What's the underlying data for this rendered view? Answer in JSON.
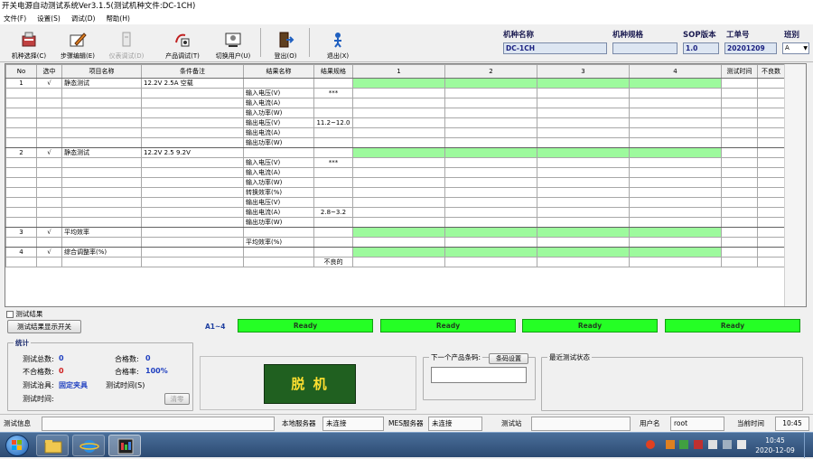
{
  "app": {
    "title": "开关电源自动测试系统Ver3.1.5(测试机种文件:DC-1CH)"
  },
  "menu": [
    "文件(F)",
    "设置(S)",
    "调试(D)",
    "帮助(H)"
  ],
  "toolbar": {
    "model_select": "机种选择(C)",
    "step_edit": "步骤编辑(E)",
    "instrument_debug": "仪表调试(D)",
    "product_debug": "产品调试(T)",
    "switch_user": "切换用户(U)",
    "logout": "登出(O)",
    "exit": "退出(X)"
  },
  "header": {
    "model_name_label": "机种名称",
    "model_name_value": "DC-1CH",
    "model_spec_label": "机种规格",
    "model_spec_value": "",
    "sop_label": "SOP版本",
    "sop_value": "1.0",
    "order_label": "工单号",
    "order_value": "20201209",
    "shift_label": "班别",
    "shift_value": "A"
  },
  "table": {
    "columns": [
      "No",
      "选中",
      "项目名称",
      "条件备注",
      "结果名称",
      "结果规格",
      "1",
      "2",
      "3",
      "4",
      "测试时间",
      "不良数"
    ],
    "rows": [
      {
        "no": "1",
        "sel": "√",
        "item": "静态测试",
        "cond": "12.2V 2.5A 空载",
        "res": "",
        "spec": "",
        "green": true
      },
      {
        "no": "",
        "sel": "",
        "item": "",
        "cond": "",
        "res": "输入电压(V)",
        "spec": "***",
        "green": false
      },
      {
        "no": "",
        "sel": "",
        "item": "",
        "cond": "",
        "res": "输入电流(A)",
        "spec": "",
        "green": false
      },
      {
        "no": "",
        "sel": "",
        "item": "",
        "cond": "",
        "res": "输入功率(W)",
        "spec": "",
        "green": false
      },
      {
        "no": "",
        "sel": "",
        "item": "",
        "cond": "",
        "res": "输出电压(V)",
        "spec": "11.2~12.0",
        "green": false
      },
      {
        "no": "",
        "sel": "",
        "item": "",
        "cond": "",
        "res": "输出电流(A)",
        "spec": "",
        "green": false
      },
      {
        "no": "",
        "sel": "",
        "item": "",
        "cond": "",
        "res": "输出功率(W)",
        "spec": "",
        "green": false,
        "sec": true
      },
      {
        "no": "2",
        "sel": "√",
        "item": "静态测试",
        "cond": "12.2V 2.5 9.2V",
        "res": "",
        "spec": "",
        "green": true
      },
      {
        "no": "",
        "sel": "",
        "item": "",
        "cond": "",
        "res": "输入电压(V)",
        "spec": "***",
        "green": false
      },
      {
        "no": "",
        "sel": "",
        "item": "",
        "cond": "",
        "res": "输入电流(A)",
        "spec": "",
        "green": false
      },
      {
        "no": "",
        "sel": "",
        "item": "",
        "cond": "",
        "res": "输入功率(W)",
        "spec": "",
        "green": false
      },
      {
        "no": "",
        "sel": "",
        "item": "",
        "cond": "",
        "res": "转换效率(%)",
        "spec": "",
        "green": false
      },
      {
        "no": "",
        "sel": "",
        "item": "",
        "cond": "",
        "res": "输出电压(V)",
        "spec": "",
        "green": false
      },
      {
        "no": "",
        "sel": "",
        "item": "",
        "cond": "",
        "res": "输出电流(A)",
        "spec": "2.8~3.2",
        "green": false
      },
      {
        "no": "",
        "sel": "",
        "item": "",
        "cond": "",
        "res": "输出功率(W)",
        "spec": "",
        "green": false,
        "sec": true
      },
      {
        "no": "3",
        "sel": "√",
        "item": "平均效率",
        "cond": "",
        "res": "",
        "spec": "",
        "green": true
      },
      {
        "no": "",
        "sel": "",
        "item": "",
        "cond": "",
        "res": "平均效率(%)",
        "spec": "",
        "green": false,
        "sec": true
      },
      {
        "no": "4",
        "sel": "√",
        "item": "综合调整率(%)",
        "cond": "",
        "res": "",
        "spec": "",
        "green": true
      },
      {
        "no": "",
        "sel": "",
        "item": "",
        "cond": "",
        "res": "",
        "spec": "不良的",
        "green": false
      }
    ]
  },
  "results": {
    "group_label": "测试结果",
    "toggle_btn": "测试结果显示开关",
    "range_label": "A1~4",
    "channels": [
      "Ready",
      "Ready",
      "Ready",
      "Ready"
    ]
  },
  "stats": {
    "label": "统计",
    "total_label": "测试总数:",
    "total": "0",
    "pass_label": "合格数:",
    "pass": "0",
    "fail_label": "不合格数:",
    "fail": "0",
    "rate_label": "合格率:",
    "rate": "100%",
    "fixture_label": "测试治具:",
    "fixture": "固定夹具",
    "time_label": "测试时间(S)",
    "test_time_label": "测试时间:",
    "clear_btn": "清零"
  },
  "release_button": "脱 机",
  "next": {
    "label": "下一个产品条码:",
    "setting_btn": "条码设置",
    "value": ""
  },
  "last_state": {
    "label": "最近测试状态"
  },
  "status": {
    "msg_label": "测试信息",
    "server_label": "本地服务器",
    "server_value": "未连接",
    "mes_label": "MES服务器",
    "mes_value": "未连接",
    "station_label": "测试站",
    "user_label": "用户名",
    "user_value": "root",
    "time_label": "当前时间",
    "time_value": "10:45"
  },
  "taskbar": {
    "time": "10:45",
    "date": "2020-12-09"
  }
}
